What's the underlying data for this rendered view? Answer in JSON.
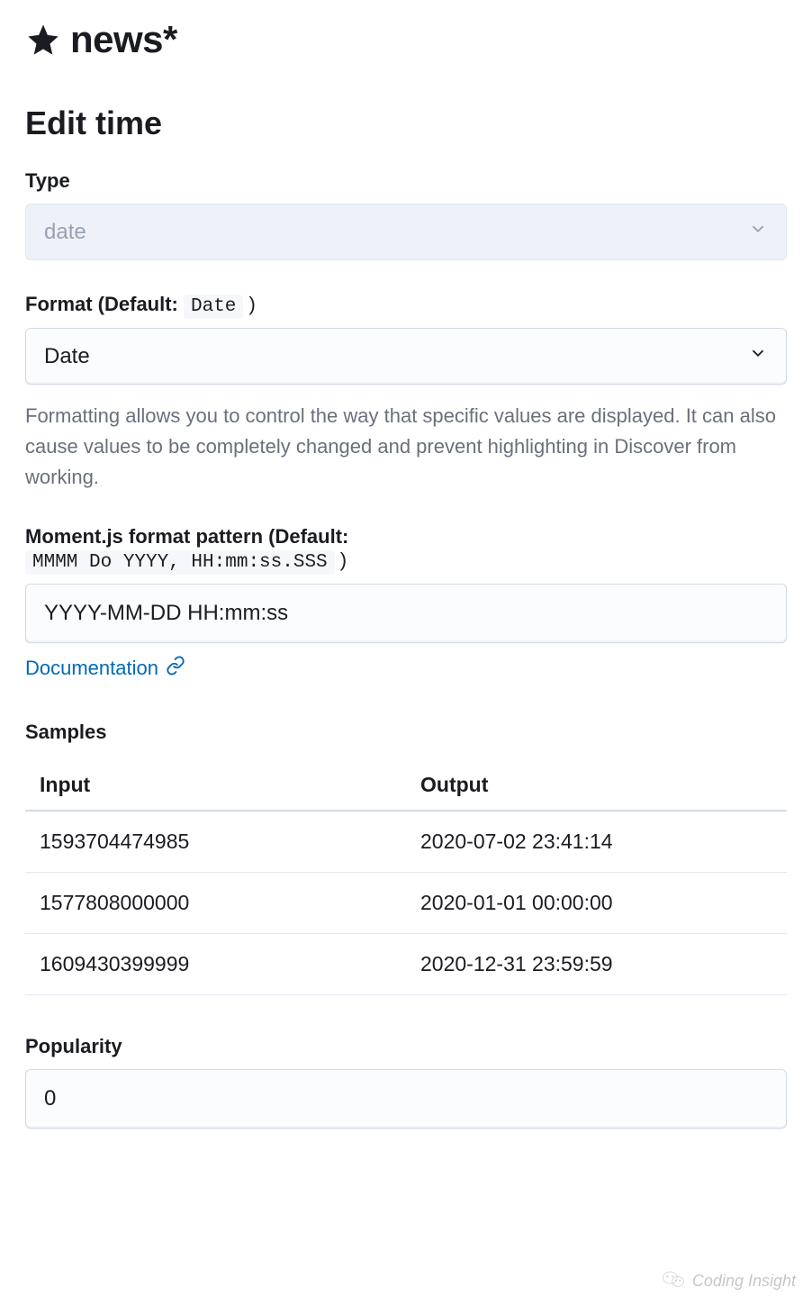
{
  "header": {
    "index_pattern": "news*"
  },
  "section_title": "Edit time",
  "type_field": {
    "label": "Type",
    "value": "date"
  },
  "format_field": {
    "label_prefix": "Format (Default: ",
    "default_code": "Date",
    "label_suffix": " )",
    "value": "Date",
    "help": "Formatting allows you to control the way that specific values are displayed. It can also cause values to be completely changed and prevent highlighting in Discover from working."
  },
  "moment_field": {
    "label_prefix": "Moment.js format pattern (Default:",
    "default_code": "MMMM Do YYYY, HH:mm:ss.SSS",
    "label_suffix": " )",
    "value": "YYYY-MM-DD HH:mm:ss",
    "doc_link_text": "Documentation"
  },
  "samples": {
    "heading": "Samples",
    "columns": {
      "input": "Input",
      "output": "Output"
    },
    "rows": [
      {
        "input": "1593704474985",
        "output": "2020-07-02 23:41:14"
      },
      {
        "input": "1577808000000",
        "output": "2020-01-01 00:00:00"
      },
      {
        "input": "1609430399999",
        "output": "2020-12-31 23:59:59"
      }
    ]
  },
  "popularity": {
    "label": "Popularity",
    "value": "0"
  },
  "watermark": "Coding Insight"
}
